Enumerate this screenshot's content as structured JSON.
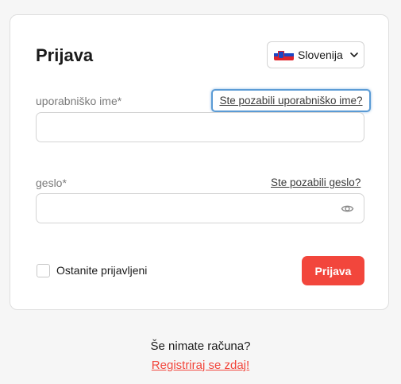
{
  "login": {
    "title": "Prijava",
    "language": {
      "selected": "Slovenija",
      "flag_icon": "slovenia-flag-icon"
    },
    "username": {
      "label": "uporabniško ime*",
      "forgot_link": "Ste pozabili uporabniško ime?",
      "value": ""
    },
    "password": {
      "label": "geslo*",
      "forgot_link": "Ste pozabili geslo?",
      "value": "",
      "toggle_icon": "eye-icon"
    },
    "remember_label": "Ostanite prijavljeni",
    "remember_checked": false,
    "submit_label": "Prijava"
  },
  "signup": {
    "prompt": "Še nimate računa?",
    "link": "Registriraj se zdaj!"
  },
  "colors": {
    "accent": "#f2463c",
    "focus_ring": "#5b9bd5"
  }
}
